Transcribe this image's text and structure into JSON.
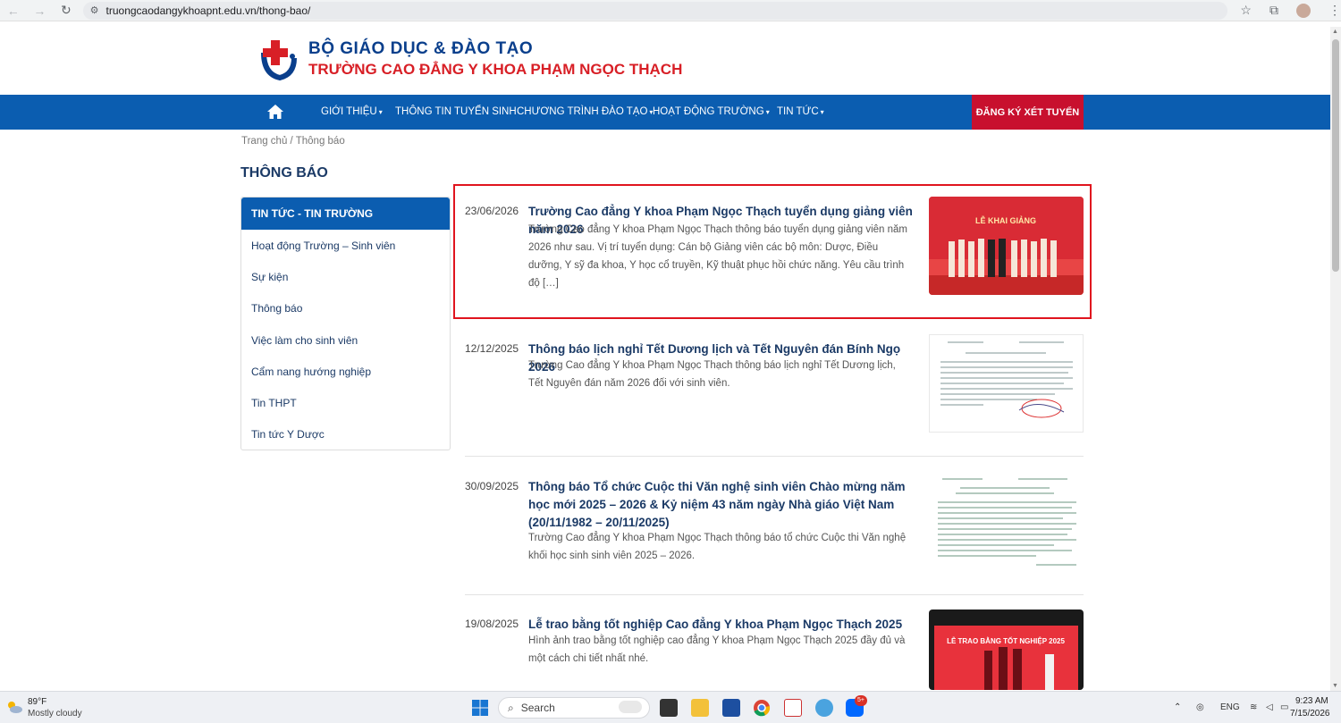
{
  "browser": {
    "url": "truongcaodangykhoapnt.edu.vn/thong-bao/"
  },
  "header": {
    "line1": "BỘ GIÁO DỤC & ĐÀO TẠO",
    "line2": "TRƯỜNG CAO ĐẲNG Y KHOA PHẠM NGỌC THẠCH"
  },
  "nav": {
    "items": [
      {
        "label": "GIỚI THIỆU",
        "dropdown": true
      },
      {
        "label": "THÔNG TIN TUYỂN SINH",
        "dropdown": false
      },
      {
        "label": "CHƯƠNG TRÌNH ĐÀO TẠO",
        "dropdown": true
      },
      {
        "label": "HOẠT ĐỘNG TRƯỜNG",
        "dropdown": true
      },
      {
        "label": "TIN TỨC",
        "dropdown": true
      }
    ],
    "cta": "ĐĂNG KÝ XÉT TUYỂN",
    "caret": "▾"
  },
  "breadcrumb": "Trang chủ / Thông báo",
  "page_title": "THÔNG BÁO",
  "sidebar": {
    "active": "TIN TỨC - TIN TRƯỜNG",
    "items": [
      "Hoạt động Trường – Sinh viên",
      "Sự kiện",
      "Thông báo",
      "Việc làm cho sinh viên",
      "Cẩm nang hướng nghiệp",
      "Tin THPT",
      "Tin tức Y Dược"
    ]
  },
  "articles": [
    {
      "date": "23/06/2026",
      "title": "Trường Cao đẳng Y khoa Phạm Ngọc Thạch tuyển dụng giảng viên năm 2026",
      "excerpt": "Trường Cao đẳng Y khoa Phạm Ngọc Thạch thông báo tuyển dụng giảng viên năm 2026 như sau.  Vị trí tuyển dụng: Cán bộ Giảng viên các bộ môn: Dược, Điều dưỡng, Y sỹ đa khoa, Y học cổ truyền, Kỹ thuật phục hồi chức năng. Yêu cầu trình độ […]",
      "thumb_text": "LỄ KHAI GIẢNG"
    },
    {
      "date": "12/12/2025",
      "title": "Thông báo lịch nghỉ Tết Dương lịch và Tết Nguyên đán Bính Ngọ 2026",
      "excerpt": "Trường Cao đẳng Y khoa Phạm Ngọc Thạch thông báo lịch nghỉ Tết Dương lịch, Tết Nguyên đán năm 2026 đối với sinh viên."
    },
    {
      "date": "30/09/2025",
      "title": "Thông báo Tổ chức Cuộc thi Văn nghệ sinh viên Chào mừng năm học mới 2025 – 2026 & Kỷ niệm 43 năm ngày Nhà giáo Việt Nam (20/11/1982 – 20/11/2025)",
      "excerpt": "Trường Cao đẳng Y khoa Phạm Ngọc Thạch thông báo tổ chức Cuộc thi Văn nghệ khối học sinh sinh viên 2025 – 2026."
    },
    {
      "date": "19/08/2025",
      "title": "Lễ trao bằng tốt nghiệp Cao đẳng Y khoa Phạm Ngọc Thạch 2025",
      "excerpt": "Hình ảnh trao bằng tốt nghiệp cao đẳng Y khoa Phạm Ngọc Thạch 2025 đầy đủ và một cách chi tiết nhất nhé.",
      "thumb_text": "LỄ TRAO BẰNG TỐT NGHIỆP 2025"
    }
  ],
  "taskbar": {
    "temp": "89°F",
    "weather": "Mostly cloudy",
    "search": "Search",
    "lang": "ENG",
    "time": "9:23 AM",
    "date": "7/15/2026",
    "badge": "5+"
  },
  "colors": {
    "nav_blue": "#0b5db0",
    "brand_red": "#c8102e",
    "title_navy": "#1b3a66",
    "highlight": "#e0141e"
  }
}
